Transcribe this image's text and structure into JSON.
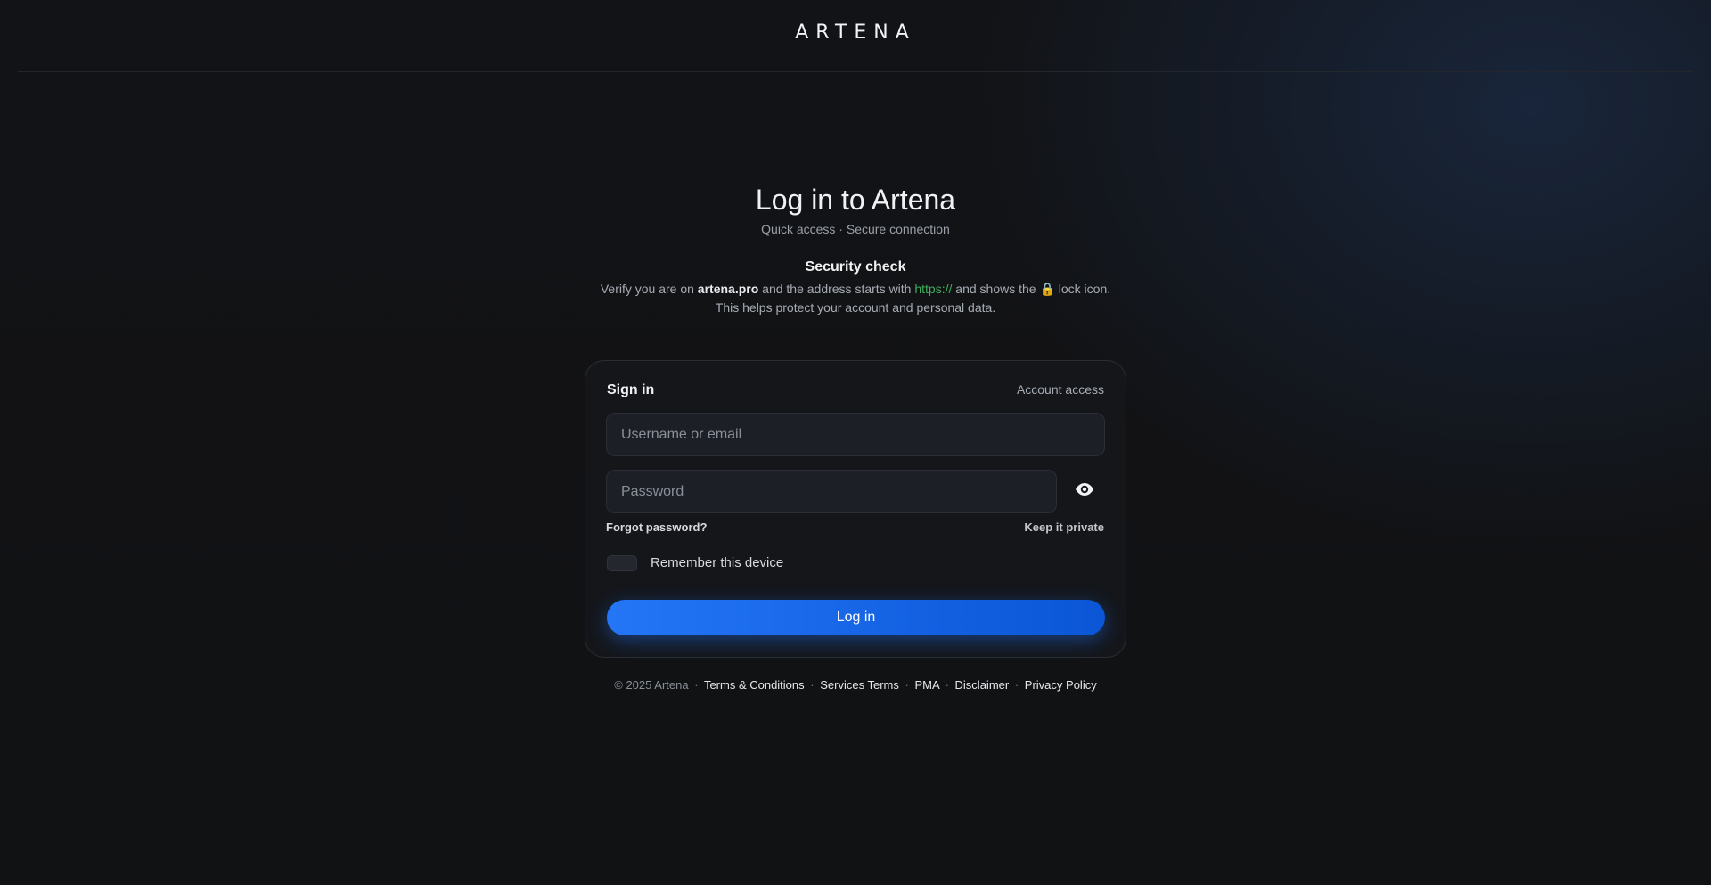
{
  "header": {
    "logo": "ARTENA"
  },
  "page": {
    "title": "Log in to Artena",
    "subtitle": "Quick access · Secure connection"
  },
  "security": {
    "title": "Security check",
    "line1_prefix": "Verify you are on ",
    "domain": "artena.pro",
    "line1_middle": " and the address starts with ",
    "https": "https://",
    "line1_suffix": " and shows the 🔒 lock icon.",
    "line2": "This helps protect your account and personal data."
  },
  "form": {
    "title": "Sign in",
    "account_access": "Account access",
    "username_placeholder": "Username or email",
    "password_placeholder": "Password",
    "forgot_password": "Forgot password?",
    "keep_private": "Keep it private",
    "remember_label": "Remember this device",
    "submit_label": "Log in"
  },
  "footer": {
    "copyright": "© 2025 Artena",
    "links": [
      "Terms & Conditions",
      "Services Terms",
      "PMA",
      "Disclaimer",
      "Privacy Policy"
    ]
  },
  "colors": {
    "accent": "#1f6ff2",
    "https_green": "#3fae5e",
    "background": "#111214"
  },
  "icons": {
    "password_toggle": "eye-icon"
  }
}
